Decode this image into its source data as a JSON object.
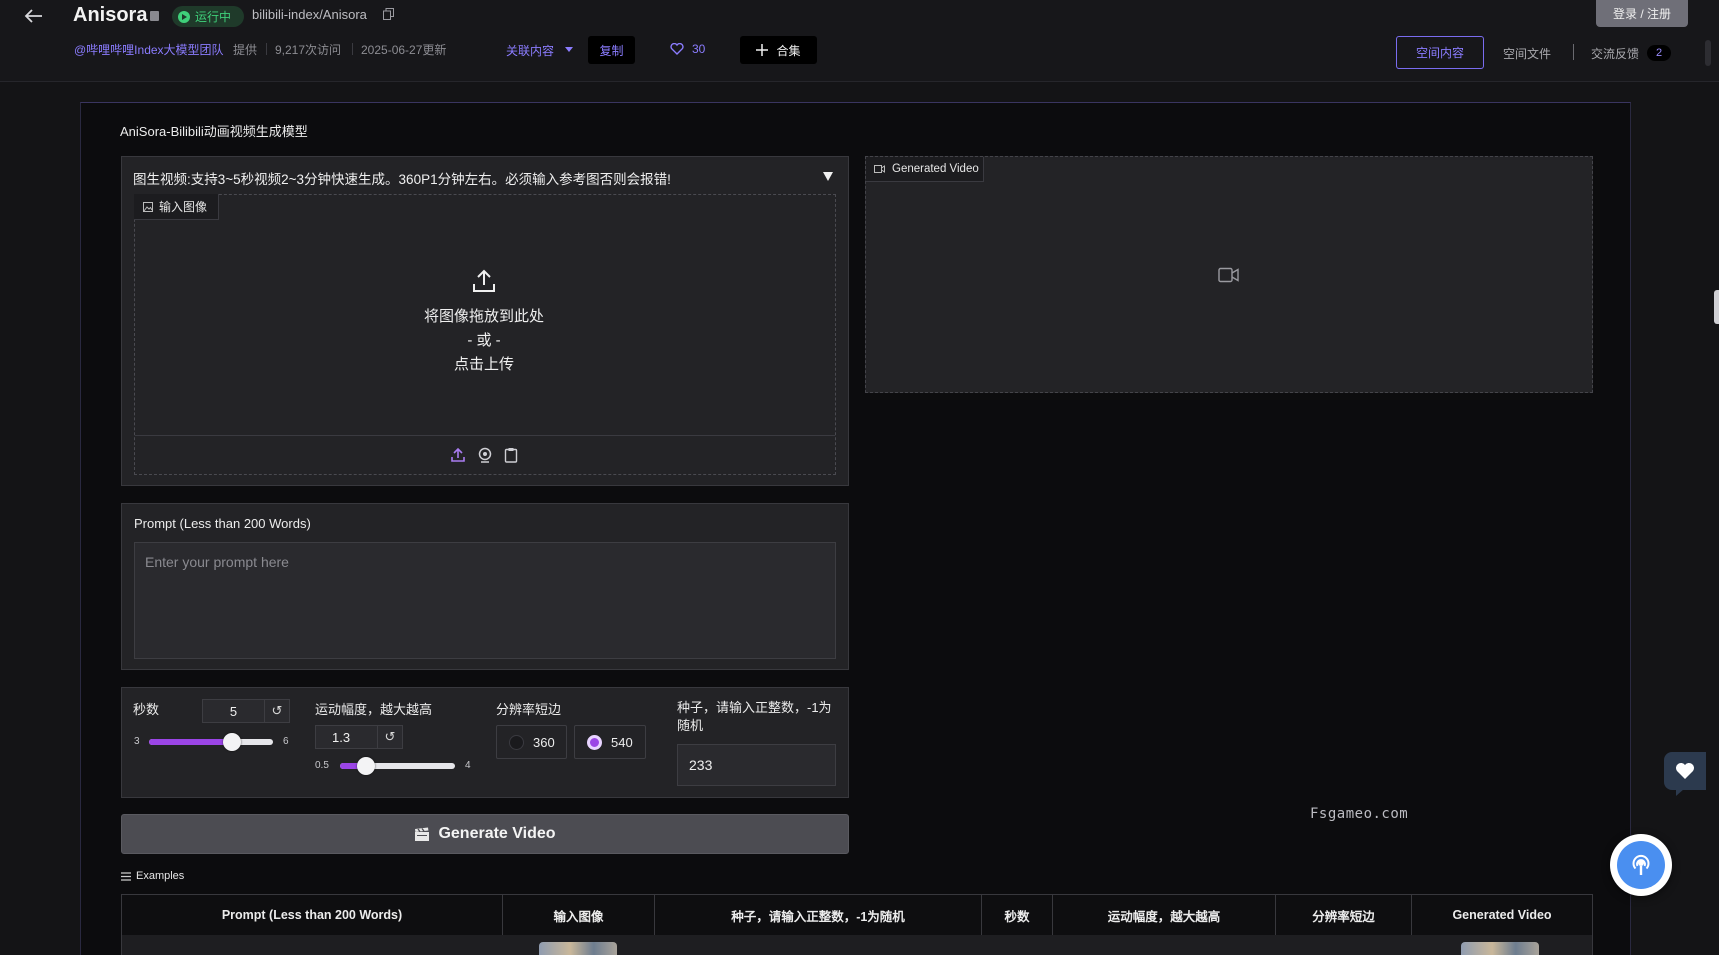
{
  "header": {
    "app_title": "Anisora",
    "status": "运行中",
    "repo_path": "bilibili-index/Anisora",
    "author": "@哔哩哔哩Index大模型团队",
    "provided": "提供",
    "visits": "9,217次访问",
    "updated": "2025-06-27更新",
    "related": "关联内容",
    "copy": "复制",
    "likes": "30",
    "collection": "合集",
    "login": "登录 / 注册",
    "nav": {
      "space_content": "空间内容",
      "space_files": "空间文件",
      "feedback": "交流反馈",
      "feedback_count": "2"
    }
  },
  "main": {
    "title": "AniSora-Bilibili动画视频生成模型",
    "accordion_title": "图生视频:支持3~5秒视频2~3分钟快速生成。360P1分钟左右。必须输入参考图否则会报错!",
    "image_input": {
      "label": "输入图像",
      "drop_text": "将图像拖放到此处",
      "or_text": "- 或 -",
      "click_text": "点击上传",
      "tools": [
        "upload-icon",
        "webcam-icon",
        "clipboard-icon"
      ]
    },
    "video_output": {
      "label": "Generated Video"
    },
    "prompt": {
      "label": "Prompt (Less than 200 Words)",
      "placeholder": "Enter your prompt here"
    },
    "seconds": {
      "label": "秒数",
      "value": "5",
      "min": "3",
      "max": "6",
      "fraction": 0.67
    },
    "motion": {
      "label": "运动幅度，越大越高",
      "value": "1.3",
      "min": "0.5",
      "max": "4",
      "fraction": 0.23
    },
    "resolution": {
      "label": "分辨率短边",
      "options": [
        "360",
        "540"
      ],
      "selected": "540"
    },
    "seed": {
      "label": "种子，请输入正整数，-1为随机",
      "value": "233"
    },
    "generate_button": "Generate Video",
    "examples": {
      "label": "Examples",
      "headers": [
        "Prompt (Less than 200 Words)",
        "输入图像",
        "种子，请输入正整数，-1为随机",
        "秒数",
        "运动幅度，越大越高",
        "分辨率短边",
        "Generated Video"
      ]
    }
  },
  "watermark": "Fsgameo.com",
  "colors": {
    "accent": "#8b7cff",
    "slider": "#9b45e6",
    "running": "#3fd07a"
  }
}
